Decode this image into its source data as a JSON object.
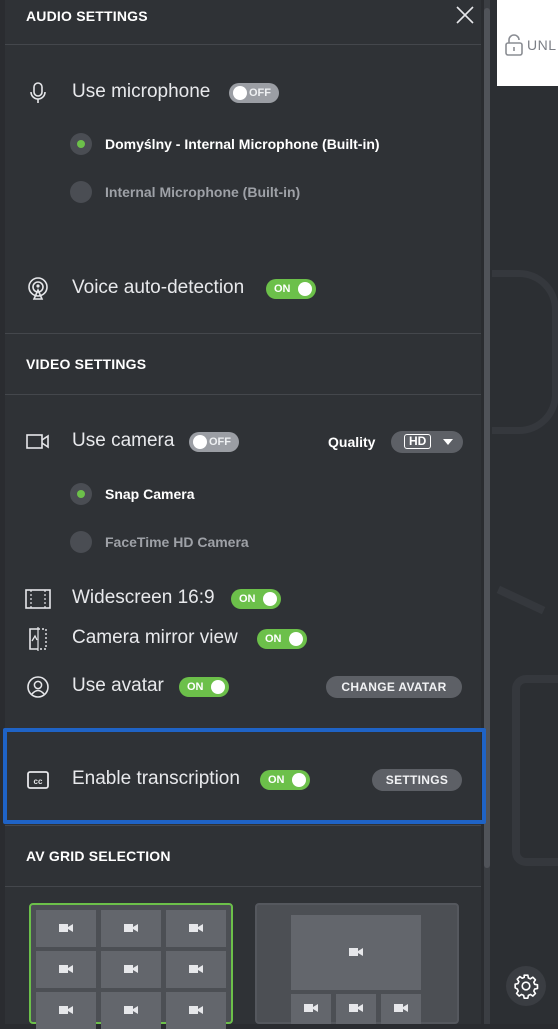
{
  "background": {
    "unlock_text": "UNL"
  },
  "audio": {
    "heading": "AUDIO SETTINGS",
    "use_microphone": "Use microphone",
    "microphone_toggle": "OFF",
    "mic_options": [
      {
        "label": "Domyślny - Internal Microphone (Built-in)",
        "selected": true
      },
      {
        "label": "Internal Microphone (Built-in)",
        "selected": false
      }
    ],
    "voice_auto_detection": "Voice auto-detection",
    "voice_toggle": "ON"
  },
  "video": {
    "heading": "VIDEO SETTINGS",
    "use_camera": "Use camera",
    "camera_toggle": "OFF",
    "quality_label": "Quality",
    "quality_value": "HD",
    "camera_options": [
      {
        "label": "Snap Camera",
        "selected": true
      },
      {
        "label": "FaceTime HD Camera",
        "selected": false
      }
    ],
    "widescreen": "Widescreen 16:9",
    "widescreen_toggle": "ON",
    "mirror": "Camera mirror view",
    "mirror_toggle": "ON",
    "avatar": "Use avatar",
    "avatar_toggle": "ON",
    "change_avatar": "CHANGE AVATAR",
    "transcription": "Enable transcription",
    "transcription_toggle": "ON",
    "settings_button": "SETTINGS"
  },
  "grid": {
    "heading": "AV GRID SELECTION"
  },
  "colors": {
    "accent_green": "#6cc04a",
    "highlight_blue": "#1f63c6",
    "panel_bg": "#2f3236"
  }
}
